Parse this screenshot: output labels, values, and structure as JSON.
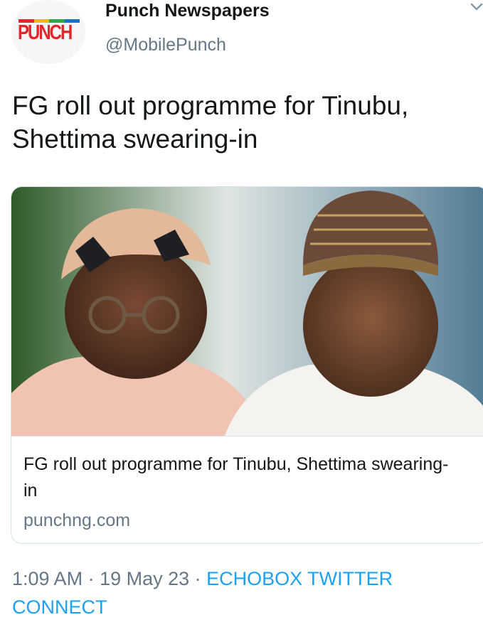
{
  "account": {
    "display_name": "Punch Newspapers",
    "handle": "@MobilePunch",
    "avatar_logo_text": "PUNCH"
  },
  "tweet": {
    "text": "FG roll out programme for Tinubu, Shettima swearing-in"
  },
  "card": {
    "title": "FG roll out programme for Tinubu, Shettima swearing-in",
    "domain": "punchng.com",
    "image_icon": "photo-icon"
  },
  "meta": {
    "time": "1:09 AM",
    "separator": " · ",
    "date": "19 May 23",
    "source": "ECHOBOX TWITTER CONNECT"
  },
  "icons": {
    "menu": "chevron-down-icon"
  },
  "colors": {
    "text_primary": "#14171a",
    "text_secondary": "#657786",
    "link": "#1da1f2",
    "logo_red": "#e3262b",
    "logo_stripe": [
      "#e3262b",
      "#f5b800",
      "#2aa84a",
      "#1b6fd1"
    ]
  }
}
